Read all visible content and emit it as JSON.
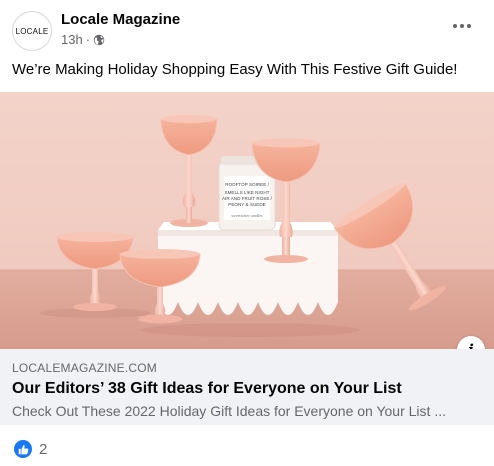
{
  "post": {
    "avatar_text": "LOCALE",
    "author": "Locale Magazine",
    "time": "13h",
    "separator": "·",
    "privacy_icon": "globe-icon",
    "caption": "We’re Making Holiday Shopping Easy With This Festive Gift Guide!"
  },
  "image": {
    "candle_label_line1": "ROOFTOP SOIREE /",
    "candle_label_line2": "SMELLS LIKE NIGHT",
    "candle_label_line3": "AIR AND FRUIT ROSE /",
    "candle_label_line4": "PEONY & SUEDE",
    "candle_brand": "sweetwater candles",
    "background_color": "#f2cfc6",
    "info_icon": "i"
  },
  "link": {
    "domain": "LOCALEMAGAZINE.COM",
    "title": "Our Editors’ 38 Gift Ideas for Everyone on Your List",
    "description": "Check Out These 2022 Holiday Gift Ideas for Everyone on Your List ..."
  },
  "reactions": {
    "icon": "like-icon",
    "count": "2"
  }
}
